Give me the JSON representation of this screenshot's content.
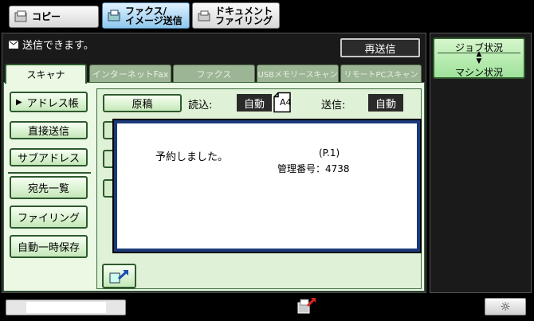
{
  "modes": [
    {
      "label": "コピー",
      "icon": "copy-icon"
    },
    {
      "label_line1": "ファクス/",
      "label_line2": "イメージ送信",
      "icon": "fax-image-send-icon"
    },
    {
      "label_line1": "ドキュメント",
      "label_line2": "ファイリング",
      "icon": "document-filing-icon"
    }
  ],
  "status": {
    "message": "送信できます。",
    "resend_label": "再送信",
    "icon": "mail-icon"
  },
  "tabs": [
    "スキャナ",
    "インターネットFax",
    "ファクス",
    "USBメモリースキャン",
    "リモートPCスキャン"
  ],
  "left_buttons": {
    "address_book": "アドレス帳",
    "direct_send": "直接送信",
    "sub_address": "サブアドレス",
    "destination_list": "宛先一覧",
    "filing": "ファイリング",
    "auto_temp_save": "自動一時保存"
  },
  "settings": {
    "original_label": "原稿",
    "read_label": "読込:",
    "read_value": "自動",
    "paper_size": "A4",
    "send_label": "送信:",
    "send_value": "自動"
  },
  "dialog": {
    "message": "予約しました。",
    "page": "(P.1)",
    "mgmt": "管理番号：4738"
  },
  "job_status": {
    "label": "ジョブ状況",
    "machine_label": "マシン状況"
  },
  "colors": {
    "panel": "#eaf8e4",
    "accent_blue": "#1b3a7a",
    "green_border": "#2d5a2d"
  }
}
